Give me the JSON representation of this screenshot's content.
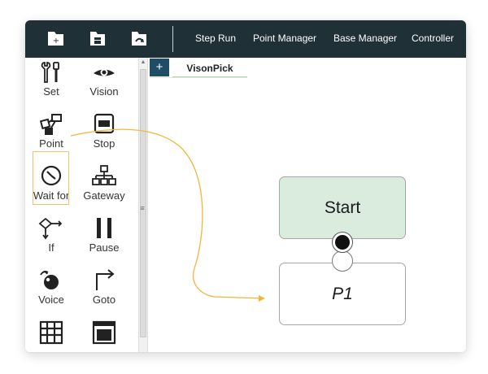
{
  "toolbar": {
    "icons": [
      "new-flow-icon",
      "save-flow-icon",
      "load-flow-icon"
    ],
    "menu": {
      "step_run": "Step Run",
      "point_manager": "Point Manager",
      "base_manager": "Base Manager",
      "controller": "Controller"
    }
  },
  "palette": {
    "items": [
      {
        "label": "Set",
        "icon": "wrench-screwdriver-icon"
      },
      {
        "label": "Vision",
        "icon": "eye-icon"
      },
      {
        "label": "Point",
        "icon": "point-nodes-icon"
      },
      {
        "label": "Stop",
        "icon": "stop-icon"
      },
      {
        "label": "Wait for",
        "icon": "clock-icon"
      },
      {
        "label": "Gateway",
        "icon": "gateway-tree-icon"
      },
      {
        "label": "If",
        "icon": "if-branch-icon"
      },
      {
        "label": "Pause",
        "icon": "pause-icon"
      },
      {
        "label": "Voice",
        "icon": "voice-icon"
      },
      {
        "label": "Goto",
        "icon": "goto-arrow-icon"
      }
    ],
    "partial_icons": [
      "grid-icon",
      "window-icon"
    ],
    "selected": "Point"
  },
  "canvas": {
    "add_tab_label": "+",
    "tab_label": "VisonPick",
    "nodes": {
      "start": "Start",
      "p1": "P1"
    }
  },
  "colors": {
    "toolbar_bg": "#1f3036",
    "accent_blue": "#1f4d66",
    "start_node_fill": "#d9ecdd",
    "drag_path": "#efb53c",
    "tab_underline": "#a9d7a8"
  }
}
